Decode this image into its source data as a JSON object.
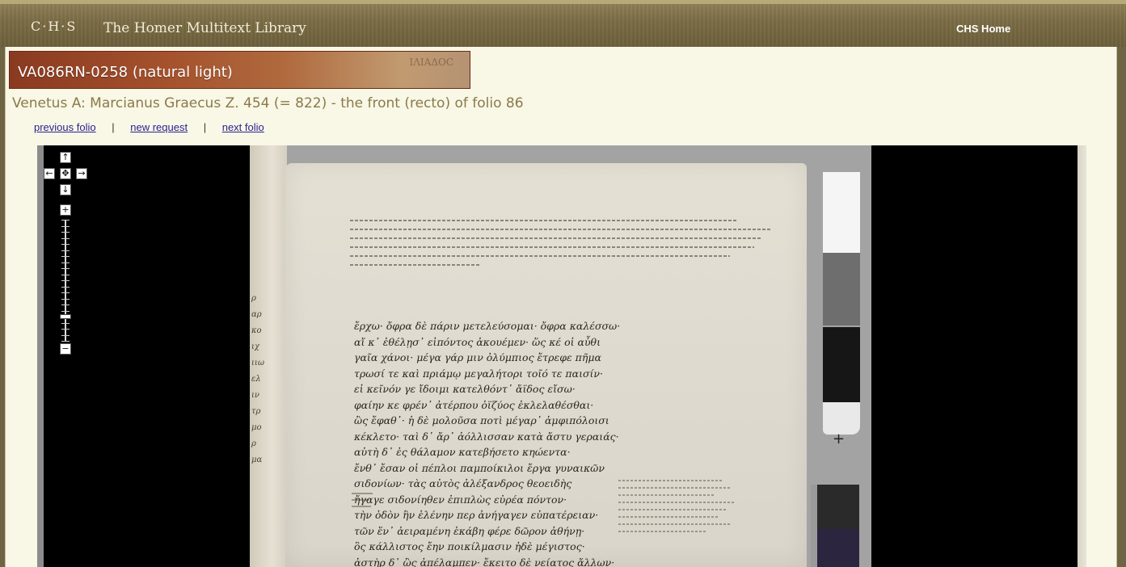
{
  "header": {
    "logo": "C·H·S",
    "title": "The Homer Multitext Library",
    "home_link": "CHS Home"
  },
  "banner": {
    "title": "VA086RN-0258 (natural light)"
  },
  "subtitle": "Venetus A: Marcianus Graecus Z. 454 (= 822) - the front (recto) of folio 86",
  "nav": {
    "previous": "previous folio",
    "separator": "|",
    "new_request": "new request",
    "next": "next folio"
  },
  "viewer": {
    "controls": {
      "pan_up": "↑",
      "pan_left": "←",
      "home": "✥",
      "pan_right": "→",
      "pan_down": "↓",
      "zoom_in": "+",
      "zoom_out": "−"
    },
    "zoom_level_fraction": 0.2
  },
  "colors": {
    "header_bg": "#7a6c45",
    "page_bg": "#f9f7e6",
    "banner_bg": "#a5522d",
    "subtitle": "#8a7a4a",
    "link": "#2c2390",
    "viewer_bg": "#000000"
  }
}
